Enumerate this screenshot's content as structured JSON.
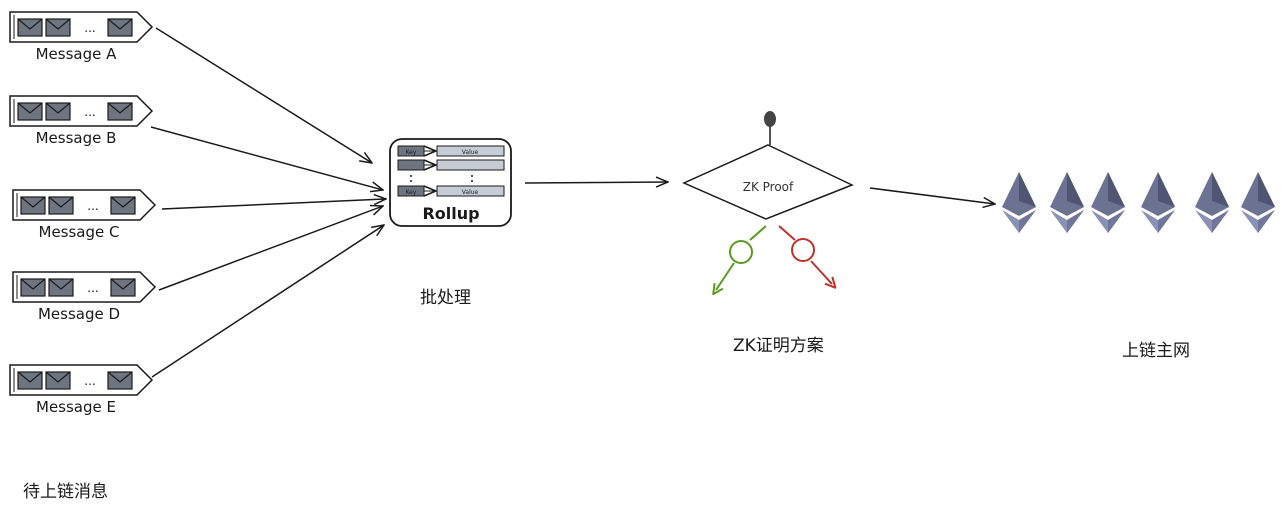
{
  "messages": [
    {
      "label": "Message A"
    },
    {
      "label": "Message B"
    },
    {
      "label": "Message C"
    },
    {
      "label": "Message D"
    },
    {
      "label": "Message E"
    }
  ],
  "queue_dots": "...",
  "rollup": {
    "title": "Rollup",
    "key_label": "Key",
    "value_label": "Value"
  },
  "zk": {
    "title": "ZK Proof"
  },
  "captions": {
    "pending": "待上链消息",
    "batch": "批处理",
    "zk": "ZK证明方案",
    "mainnet": "上链主网"
  },
  "colors": {
    "ink": "#1a1a1a",
    "envelope": "#6e7580",
    "slot": "#c7ccd4",
    "yes": "#5a9a1e",
    "no": "#c0302c",
    "eth_top": "#6b7292",
    "eth_bottom": "#8a91b4"
  },
  "icons": [
    "envelope-icon",
    "ethereum-icon",
    "arrow-icon"
  ]
}
